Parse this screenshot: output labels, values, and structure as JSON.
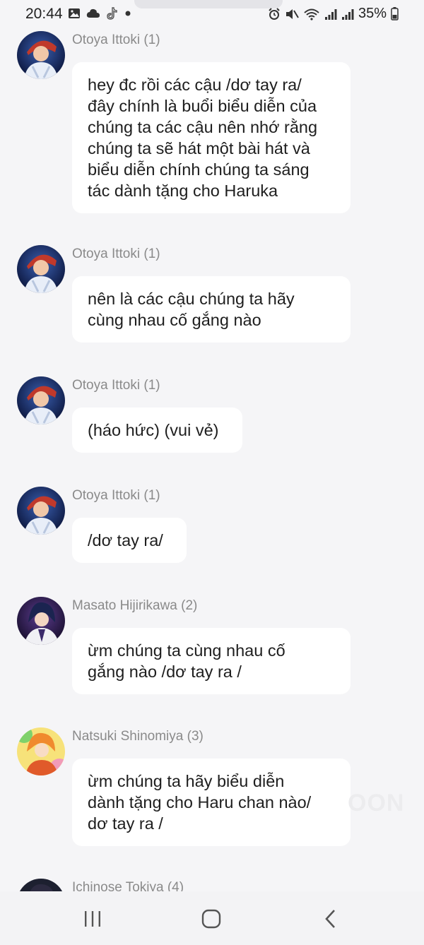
{
  "status_bar": {
    "time": "20:44",
    "battery_percent": "35%",
    "notification_icons": [
      "gallery-icon",
      "cloud-icon",
      "tiktok-icon",
      "dot-icon"
    ],
    "system_icons": [
      "alarm-icon",
      "mute-icon",
      "wifi-icon",
      "signal-icon",
      "signal-icon",
      "battery-icon"
    ]
  },
  "messages": [
    {
      "sender": "Otoya Ittoki (1)",
      "text": "hey đc rồi các cậu /dơ tay ra/\nđây chính là buổi biểu diễn của\nchúng ta các cậu nên nhớ rằng\nchúng ta sẽ hát một bài hát và\nbiểu diễn chính chúng ta sáng\ntác dành tặng cho Haruka"
    },
    {
      "sender": "Otoya Ittoki (1)",
      "text": "nên là các cậu chúng ta hãy\ncùng nhau cố gắng nào"
    },
    {
      "sender": "Otoya Ittoki (1)",
      "text": "(háo hức) (vui vẻ)"
    },
    {
      "sender": "Otoya Ittoki (1)",
      "text": "/dơ tay ra/"
    },
    {
      "sender": "Masato Hijirikawa (2)",
      "text": "ừm chúng ta cùng nhau cố\ngắng nào /dơ tay ra /"
    },
    {
      "sender": "Natsuki Shinomiya (3)",
      "text": "ừm chúng ta hãy biểu diễn\ndành tặng cho Haru chan nào/\ndơ tay ra /"
    },
    {
      "sender": "Ichinose Tokiya (4)",
      "text": ""
    }
  ],
  "watermark": "OON",
  "nav_bar": {
    "buttons": [
      "recent-apps-icon",
      "home-icon",
      "back-icon"
    ]
  },
  "colors": {
    "background": "#f5f5f7",
    "bubble": "#ffffff",
    "sender_text": "#8a8a8a",
    "message_text": "#1e1e1e"
  }
}
